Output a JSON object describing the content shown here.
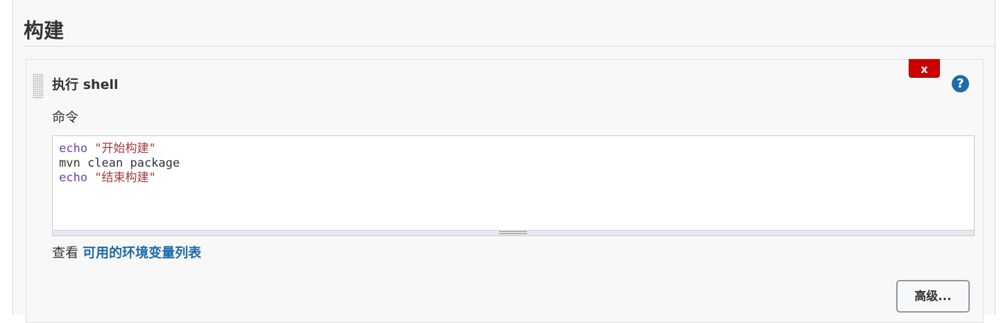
{
  "section": {
    "title": "构建"
  },
  "step": {
    "title": "执行 shell",
    "delete_label": "x",
    "help_label": "?",
    "command_label": "命令",
    "command_lines": [
      {
        "keyword": "echo",
        "rest": " \"开始构建\"",
        "rest_type": "string"
      },
      {
        "keyword": "",
        "rest": "mvn clean package",
        "rest_type": "plain"
      },
      {
        "keyword": "echo",
        "rest": " \"结束构建\"",
        "rest_type": "string"
      }
    ],
    "env_prefix": "查看 ",
    "env_link": "可用的环境变量列表",
    "advanced_label": "高级..."
  },
  "colors": {
    "delete_button": "#cc0000",
    "help_icon": "#1c6ca6",
    "link": "#1d6ba8",
    "keyword": "#6f3fa6",
    "string": "#a33a3a"
  }
}
